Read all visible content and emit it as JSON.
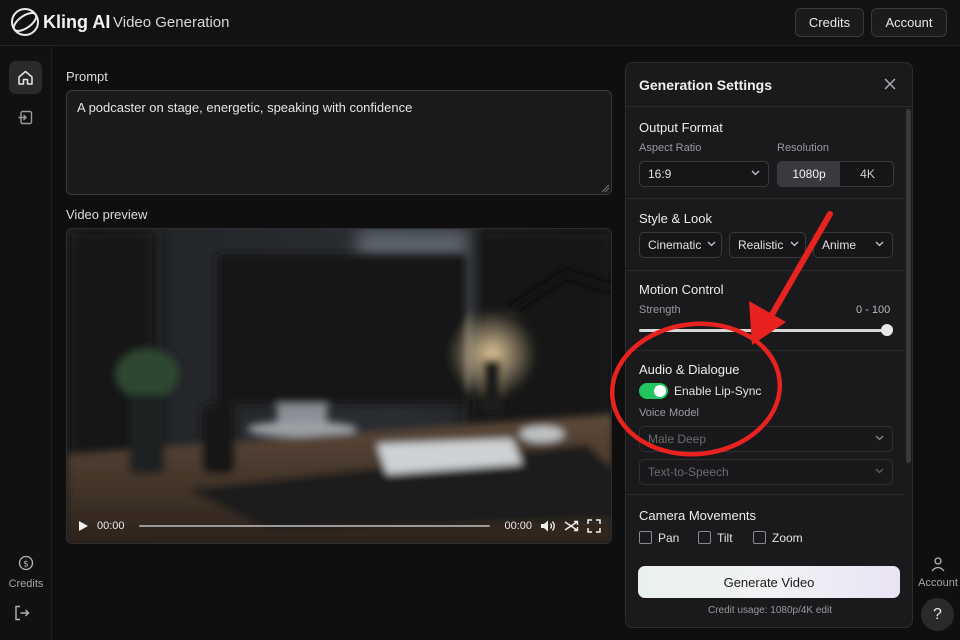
{
  "header": {
    "brand": "Kling AI",
    "page_title": "Video Generation",
    "credits_label": "Credits",
    "account_label": "Account"
  },
  "rail": {
    "credits_label": "Credits"
  },
  "main": {
    "prompt_label": "Prompt",
    "prompt_value": "A podcaster on stage, energetic, speaking with confidence",
    "video_label": "Video preview",
    "time_current": "00:00",
    "time_total": "00:00"
  },
  "panel": {
    "title": "Generation Settings",
    "output": {
      "title": "Output Format",
      "aspect_label": "Aspect Ratio",
      "aspect_value": "16:9",
      "resolution_label": "Resolution",
      "res_options": [
        "1080p",
        "4K"
      ],
      "res_selected": "1080p"
    },
    "style": {
      "title": "Style & Look",
      "selects": [
        "Cinematic",
        "Realistic",
        "Anime"
      ]
    },
    "motion": {
      "title": "Motion Control",
      "strength_label": "Strength",
      "range_label": "0 - 100",
      "strength_fraction": 1.0
    },
    "audio": {
      "title": "Audio & Dialogue",
      "lipsync_label": "Enable Lip-Sync",
      "lipsync_on": true,
      "voice_model_label": "Voice Model",
      "voice_model_value": "Male Deep",
      "tts_value": "Text-to-Speech"
    },
    "camera": {
      "title": "Camera Movements",
      "options": [
        "Pan",
        "Tilt",
        "Zoom"
      ]
    },
    "generate_label": "Generate Video",
    "credit_usage": "Credit usage: 1080p/4K edit"
  },
  "side": {
    "account_label": "Account",
    "help_label": "?"
  },
  "colors": {
    "toggle_on": "#22c55e",
    "annotation_red": "#e8231f"
  }
}
